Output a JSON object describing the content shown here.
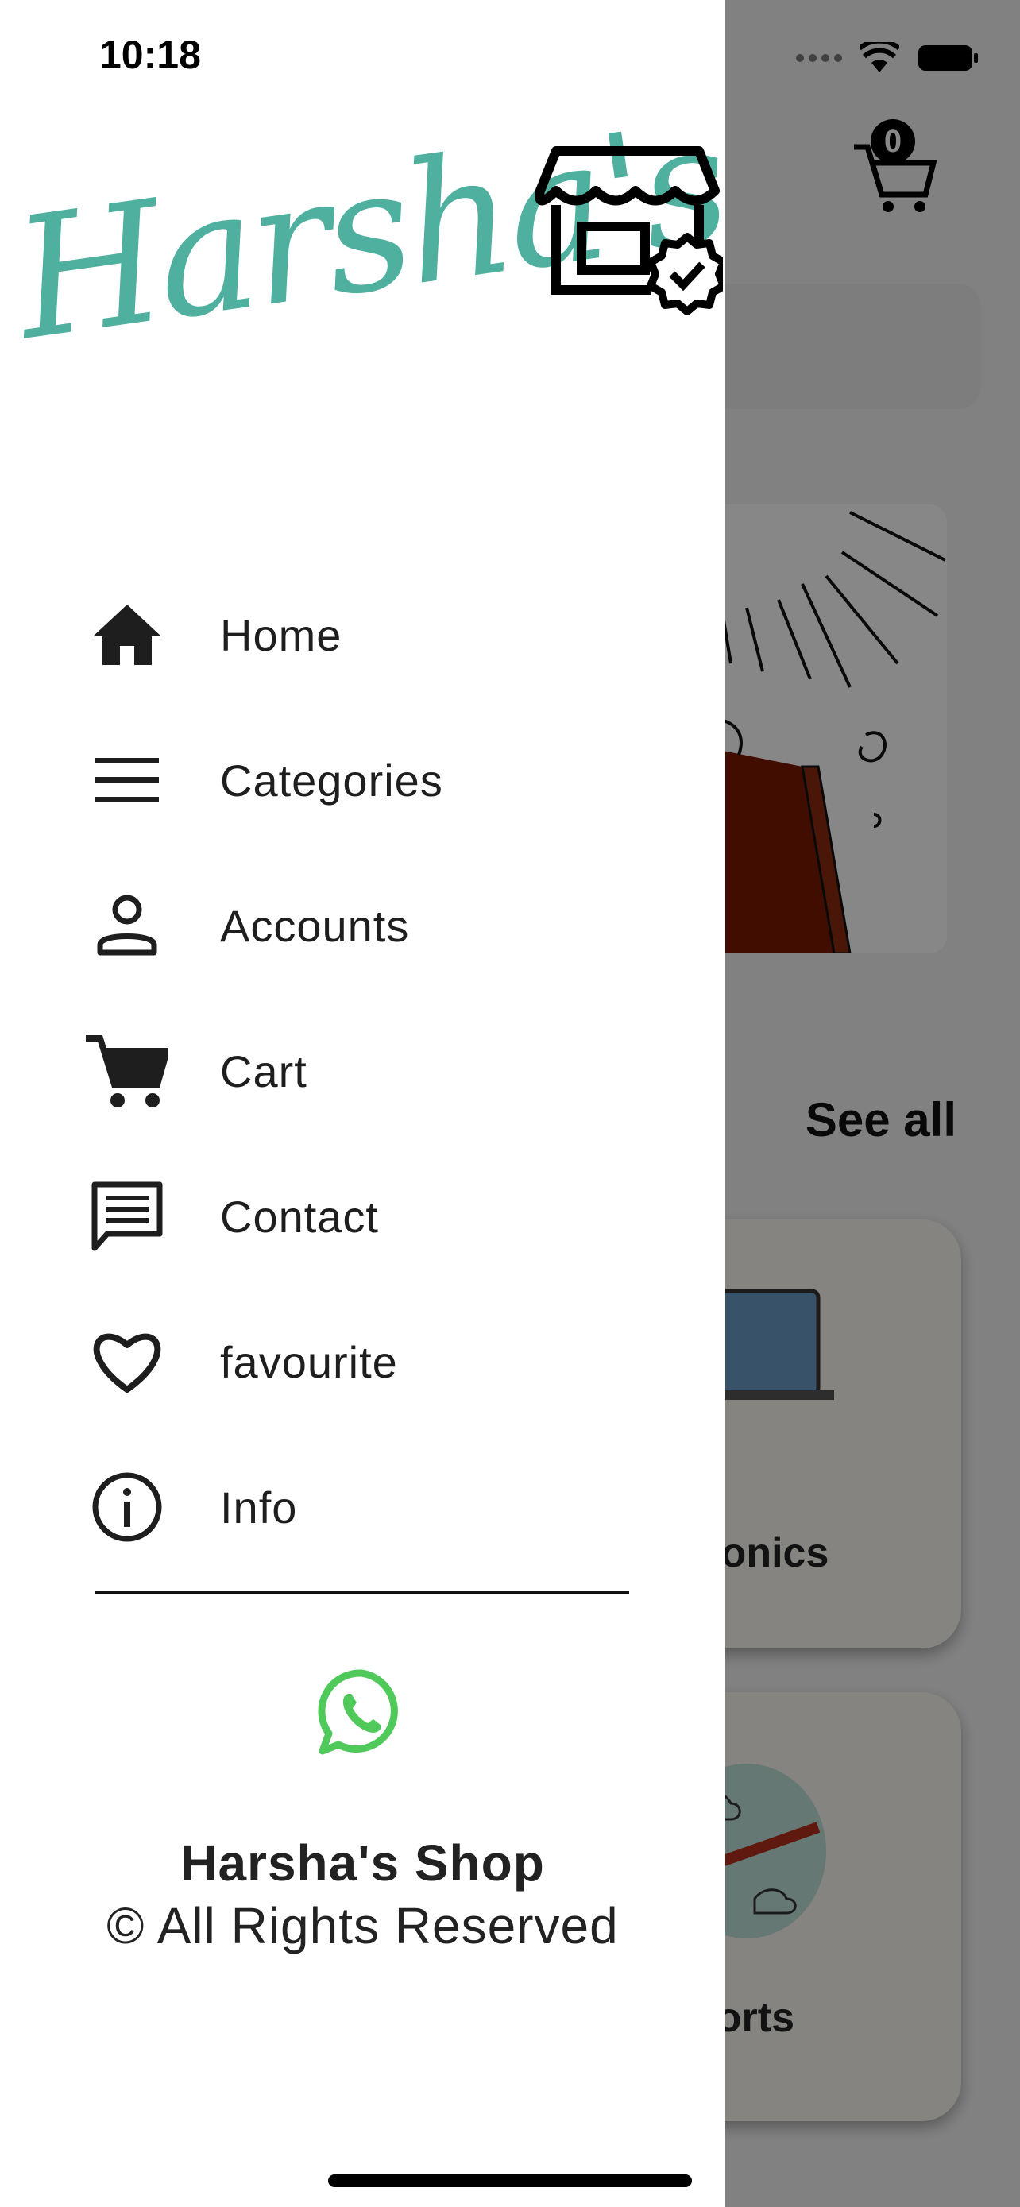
{
  "status_bar": {
    "time": "10:18"
  },
  "background": {
    "cart_count": "0",
    "see_all": "See all",
    "cards": [
      {
        "label": "tronics"
      },
      {
        "label": "ports"
      }
    ]
  },
  "drawer": {
    "logo_text": "Harsha's",
    "menu": [
      {
        "icon": "home-icon",
        "label": "Home"
      },
      {
        "icon": "menu-lines-icon",
        "label": "Categories"
      },
      {
        "icon": "person-icon",
        "label": "Accounts"
      },
      {
        "icon": "cart-icon",
        "label": "Cart"
      },
      {
        "icon": "chat-icon",
        "label": "Contact"
      },
      {
        "icon": "heart-icon",
        "label": "favourite"
      },
      {
        "icon": "info-icon",
        "label": "Info"
      }
    ],
    "footer": {
      "title": "Harsha's Shop",
      "rights": "© All Rights Reserved"
    }
  },
  "colors": {
    "brand_teal": "#4fb0a0",
    "whatsapp_green": "#4ec95a",
    "bag_red": "#7a1a00"
  }
}
